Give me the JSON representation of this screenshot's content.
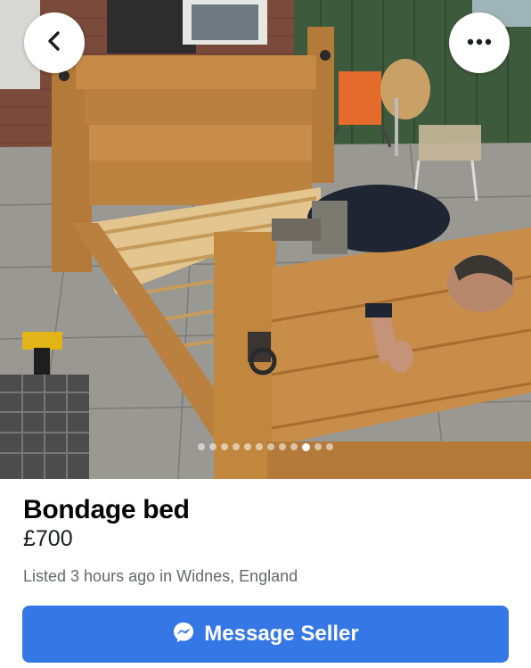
{
  "listing": {
    "title": "Bondage bed",
    "price": "£700",
    "meta": "Listed 3 hours ago in Widnes, England"
  },
  "header": {
    "back_icon": "chevron-left-icon",
    "more_icon": "more-horizontal-icon"
  },
  "carousel": {
    "total": 12,
    "active_index": 9
  },
  "actions": {
    "message_label": "Message Seller",
    "message_icon": "messenger-icon"
  },
  "colors": {
    "accent": "#3578e5",
    "title": "#050505",
    "meta": "#65676b"
  }
}
